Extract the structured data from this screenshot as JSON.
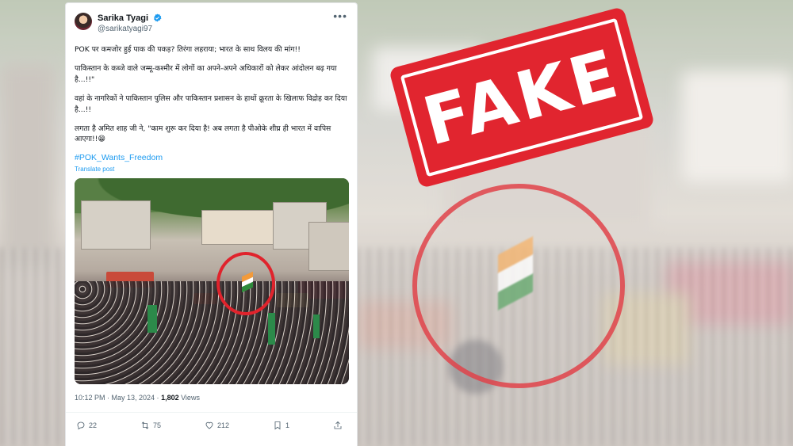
{
  "stamp": {
    "text": "FAKE",
    "color": "#e1252f"
  },
  "tweet": {
    "author_name": "Sarika Tyagi",
    "author_handle": "@sarikatyagi97",
    "paragraphs": [
      "POK पर कमजोर हुई पाक की पकड़? तिरंगा लहराया; भारत के साथ विलय की मांग!!",
      "पाकिस्तान के कब्जे वाले जम्मू-कश्मीर में लोगों का अपने-अपने अधिकारों को लेकर आंदोलन बढ़ गया है...!!\"",
      "वहां के नागरिकों ने पाकिस्तान पुलिस और पाकिस्तान प्रशासन के हाथों क्रूरता के खिलाफ विद्रोह कर दिया है...!!",
      "लगता है अमित शाह जी ने, \"काम शुरू कर दिया है! अब लगता है पीओके शीघ्र ही भारत में वापिस आएगा!!😁"
    ],
    "hashtag": "#POK_Wants_Freedom",
    "translate_label": "Translate post",
    "timestamp": "10:12 PM · May 13, 2024 · ",
    "views_count": "1,802",
    "views_label": " Views",
    "actions": {
      "replies": "22",
      "reposts": "75",
      "likes": "212",
      "bookmarks": "1"
    }
  },
  "colors": {
    "link": "#1d9bf0",
    "verified": "#1d9bf0",
    "circle": "#e0232c",
    "flag_saffron": "#f29a3a",
    "flag_white": "#ffffff",
    "flag_green": "#2e8b3a"
  }
}
